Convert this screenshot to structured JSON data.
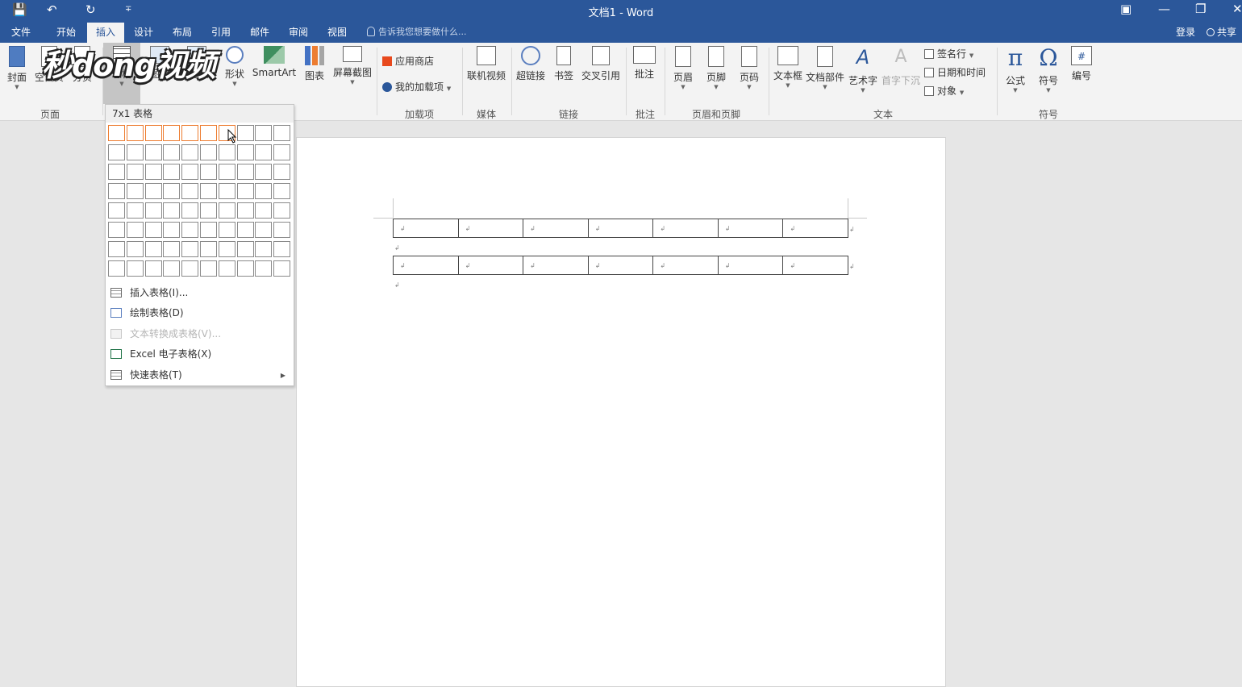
{
  "titlebar": {
    "title": "文档1 - Word",
    "qa_save": "💾",
    "qa_undo": "↶",
    "qa_redo": "↻",
    "qa_more": "∓",
    "btn_ribbon_opts": "▣",
    "btn_minimize": "—",
    "btn_restore": "❐",
    "btn_close": "✕"
  },
  "tabs": [
    {
      "label": "文件"
    },
    {
      "label": "开始"
    },
    {
      "label": "插入"
    },
    {
      "label": "设计"
    },
    {
      "label": "布局"
    },
    {
      "label": "引用"
    },
    {
      "label": "邮件"
    },
    {
      "label": "审阅"
    },
    {
      "label": "视图"
    }
  ],
  "tellme": "告诉我您想要做什么...",
  "account": {
    "login": "登录",
    "share": "共享"
  },
  "ribbon": {
    "pages": {
      "cover": "封面",
      "blank": "空白页",
      "break": "分页",
      "group": "页面"
    },
    "tables": {
      "table": "表格"
    },
    "illustrations": {
      "pictures": "图片",
      "online_pictures": "联机图片",
      "shapes": "形状",
      "smartart": "SmartArt",
      "chart": "图表",
      "screenshot": "屏幕截图"
    },
    "addins": {
      "store": "应用商店",
      "my_addins": "我的加载项",
      "group": "加载项"
    },
    "media": {
      "online_video": "联机视频",
      "group": "媒体"
    },
    "links": {
      "hyperlink": "超链接",
      "bookmark": "书签",
      "crossref": "交叉引用",
      "group": "链接"
    },
    "comments": {
      "comment": "批注",
      "group": "批注"
    },
    "header_footer": {
      "header": "页眉",
      "footer": "页脚",
      "page_number": "页码",
      "group": "页眉和页脚"
    },
    "text": {
      "textbox": "文本框",
      "quickparts": "文档部件",
      "wordart": "艺术字",
      "dropcap": "首字下沉",
      "signature": "签名行",
      "datetime": "日期和时间",
      "object": "对象",
      "group": "文本"
    },
    "symbols": {
      "equation": "公式",
      "symbol": "符号",
      "number": "编号",
      "group": "符号"
    }
  },
  "logo_text": "秒dong视频",
  "table_menu": {
    "header": "7x1 表格",
    "grid_cols": 10,
    "grid_rows": 8,
    "selected_cols": 7,
    "selected_rows": 1,
    "items": [
      {
        "label": "插入表格(I)...",
        "enabled": true
      },
      {
        "label": "绘制表格(D)",
        "enabled": true
      },
      {
        "label": "文本转换成表格(V)...",
        "enabled": false
      },
      {
        "label": "Excel 电子表格(X)",
        "enabled": true
      },
      {
        "label": "快速表格(T)",
        "enabled": true,
        "submenu": true
      }
    ]
  },
  "document": {
    "tables": [
      {
        "cols": 7,
        "rows": 1
      },
      {
        "cols": 7,
        "rows": 1
      }
    ],
    "para_mark": "↲"
  }
}
